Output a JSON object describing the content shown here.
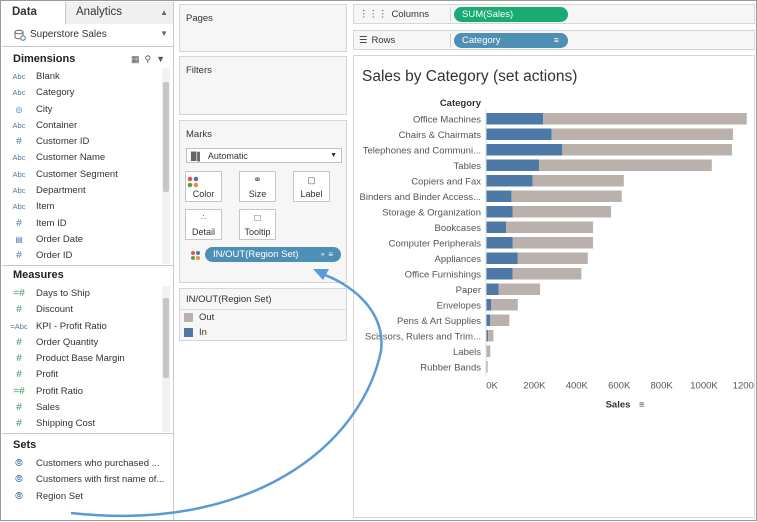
{
  "datapane": {
    "tabs": [
      {
        "label": "Data"
      },
      {
        "label": "Analytics"
      }
    ],
    "source": "Superstore Sales",
    "dimensions_header": "Dimensions",
    "dimensions": [
      {
        "icon": "abc",
        "label": "Blank"
      },
      {
        "icon": "abc",
        "label": "Category"
      },
      {
        "icon": "globe",
        "label": "City"
      },
      {
        "icon": "abc",
        "label": "Container"
      },
      {
        "icon": "num",
        "label": "Customer ID"
      },
      {
        "icon": "abc",
        "label": "Customer Name"
      },
      {
        "icon": "abc",
        "label": "Customer Segment"
      },
      {
        "icon": "abc",
        "label": "Department"
      },
      {
        "icon": "abc",
        "label": "Item"
      },
      {
        "icon": "num",
        "label": "Item ID"
      },
      {
        "icon": "date",
        "label": "Order Date"
      },
      {
        "icon": "num",
        "label": "Order ID"
      }
    ],
    "measures_header": "Measures",
    "measures": [
      {
        "icon": "calc",
        "label": "Days to Ship"
      },
      {
        "icon": "num",
        "label": "Discount"
      },
      {
        "icon": "abc-calc",
        "label": "KPI - Profit Ratio"
      },
      {
        "icon": "num",
        "label": "Order Quantity"
      },
      {
        "icon": "num",
        "label": "Product Base Margin"
      },
      {
        "icon": "num",
        "label": "Profit"
      },
      {
        "icon": "calc",
        "label": "Profit Ratio"
      },
      {
        "icon": "num",
        "label": "Sales"
      },
      {
        "icon": "num",
        "label": "Shipping Cost"
      }
    ],
    "sets_header": "Sets",
    "sets": [
      {
        "label": "Customers who purchased ..."
      },
      {
        "label": "Customers with first name of..."
      },
      {
        "label": "Region Set"
      }
    ]
  },
  "cards": {
    "pages": "Pages",
    "filters": "Filters",
    "marks": "Marks",
    "mark_type": "Automatic",
    "mark_buttons": [
      {
        "label": "Color",
        "icon": "color-dots-icon"
      },
      {
        "label": "Size",
        "icon": "size-icon"
      },
      {
        "label": "Label",
        "icon": "label-icon"
      },
      {
        "label": "Detail",
        "icon": "detail-icon"
      },
      {
        "label": "Tooltip",
        "icon": "tooltip-icon"
      }
    ],
    "color_pill": "IN/OUT(Region Set)",
    "legend_title": "IN/OUT(Region Set)",
    "legend": [
      {
        "label": "Out",
        "color": "#bab0ac"
      },
      {
        "label": "In",
        "color": "#4e79a7"
      }
    ]
  },
  "shelves": {
    "columns_label": "Columns",
    "columns_pill": "SUM(Sales)",
    "rows_label": "Rows",
    "rows_pill": "Category"
  },
  "view": {
    "title": "Sales by Category (set actions)"
  },
  "chart_data": {
    "type": "bar",
    "orientation": "horizontal",
    "stacked": true,
    "title": "Sales by Category (set actions)",
    "row_header": "Category",
    "xlabel": "Sales",
    "xlim": [
      0,
      1250000
    ],
    "x_ticks": [
      "0K",
      "200K",
      "400K",
      "600K",
      "800K",
      "1000K",
      "1200K"
    ],
    "categories": [
      "Office Machines",
      "Chairs & Chairmats",
      "Telephones and Communi...",
      "Tables",
      "Copiers and Fax",
      "Binders and Binder Access...",
      "Storage & Organization",
      "Bookcases",
      "Computer Peripherals",
      "Appliances",
      "Office Furnishings",
      "Paper",
      "Envelopes",
      "Pens & Art Supplies",
      "Scissors, Rulers and Trim...",
      "Labels",
      "Rubber Bands"
    ],
    "series": [
      {
        "name": "In",
        "color": "#4e79a7",
        "values": [
          270000,
          310000,
          360000,
          250000,
          220000,
          120000,
          125000,
          95000,
          125000,
          150000,
          125000,
          60000,
          25000,
          20000,
          10000,
          3000,
          1500
        ]
      },
      {
        "name": "Out",
        "color": "#bab0ac",
        "values": [
          960000,
          855000,
          800000,
          815000,
          430000,
          520000,
          465000,
          410000,
          380000,
          330000,
          325000,
          195000,
          125000,
          90000,
          25000,
          17000,
          6500
        ]
      }
    ]
  }
}
